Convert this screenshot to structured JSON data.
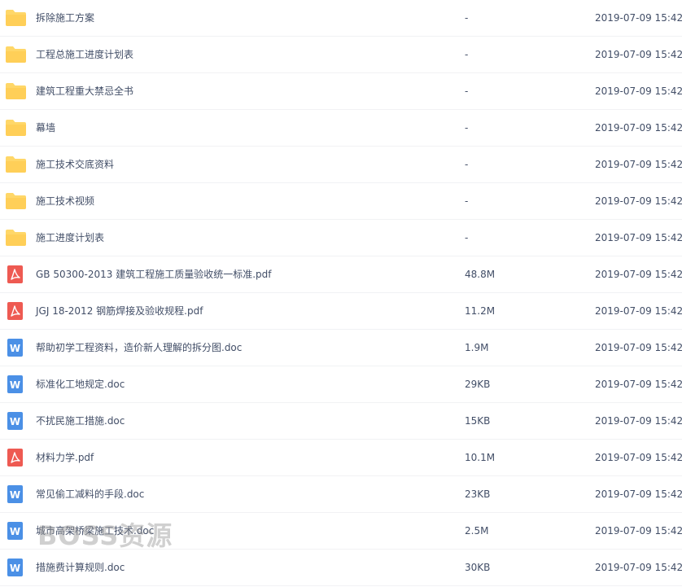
{
  "files": [
    {
      "name": "拆除施工方案",
      "size": "-",
      "time": "2019-07-09 15:42",
      "type": "folder",
      "icon": "folder-icon"
    },
    {
      "name": "工程总施工进度计划表",
      "size": "-",
      "time": "2019-07-09 15:42",
      "type": "folder",
      "icon": "folder-icon"
    },
    {
      "name": "建筑工程重大禁忌全书",
      "size": "-",
      "time": "2019-07-09 15:42",
      "type": "folder",
      "icon": "folder-icon"
    },
    {
      "name": "幕墙",
      "size": "-",
      "time": "2019-07-09 15:42",
      "type": "folder",
      "icon": "folder-icon"
    },
    {
      "name": "施工技术交底资料",
      "size": "-",
      "time": "2019-07-09 15:42",
      "type": "folder",
      "icon": "folder-icon"
    },
    {
      "name": "施工技术视频",
      "size": "-",
      "time": "2019-07-09 15:42",
      "type": "folder",
      "icon": "folder-icon"
    },
    {
      "name": "施工进度计划表",
      "size": "-",
      "time": "2019-07-09 15:42",
      "type": "folder",
      "icon": "folder-icon"
    },
    {
      "name": "GB 50300-2013 建筑工程施工质量验收统一标准.pdf",
      "size": "48.8M",
      "time": "2019-07-09 15:42",
      "type": "pdf",
      "icon": "pdf-icon"
    },
    {
      "name": "JGJ 18-2012 钢筋焊接及验收规程.pdf",
      "size": "11.2M",
      "time": "2019-07-09 15:42",
      "type": "pdf",
      "icon": "pdf-icon"
    },
    {
      "name": "帮助初学工程资料，造价新人理解的拆分图.doc",
      "size": "1.9M",
      "time": "2019-07-09 15:42",
      "type": "doc",
      "icon": "word-icon"
    },
    {
      "name": "标准化工地规定.doc",
      "size": "29KB",
      "time": "2019-07-09 15:42",
      "type": "doc",
      "icon": "word-icon"
    },
    {
      "name": "不扰民施工措施.doc",
      "size": "15KB",
      "time": "2019-07-09 15:42",
      "type": "doc",
      "icon": "word-icon"
    },
    {
      "name": "材料力学.pdf",
      "size": "10.1M",
      "time": "2019-07-09 15:42",
      "type": "pdf",
      "icon": "pdf-icon"
    },
    {
      "name": "常见偷工减料的手段.doc",
      "size": "23KB",
      "time": "2019-07-09 15:42",
      "type": "doc",
      "icon": "word-icon"
    },
    {
      "name": "城市高架桥梁施工技术.doc",
      "size": "2.5M",
      "time": "2019-07-09 15:42",
      "type": "doc",
      "icon": "word-icon"
    },
    {
      "name": "措施费计算规则.doc",
      "size": "30KB",
      "time": "2019-07-09 15:42",
      "type": "doc",
      "icon": "word-icon"
    }
  ],
  "watermark": "BOSS资源",
  "colors": {
    "folder": "#ffd768",
    "pdf": "#ee5a52",
    "word": "#4b90e6",
    "text": "#424e67",
    "divider": "#f1f2f4"
  }
}
